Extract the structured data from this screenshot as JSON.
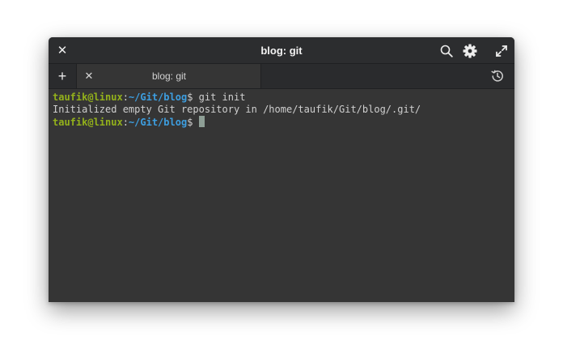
{
  "window": {
    "title": "blog: git"
  },
  "titlebar": {
    "close_icon": "✕",
    "search_icon": "search-icon",
    "settings_icon": "gear-icon",
    "maximize_icon": "maximize-icon"
  },
  "tabs": {
    "add_label": "+",
    "items": [
      {
        "label": "blog: git",
        "close_label": "✕"
      }
    ],
    "history_icon": "history-icon"
  },
  "terminal": {
    "lines": [
      {
        "user_host": "taufik@linux",
        "sep": ":",
        "path": "~/Git/blog",
        "prompt": "$",
        "command": " git init"
      },
      {
        "output": "Initialized empty Git repository in /home/taufik/Git/blog/.git/"
      },
      {
        "user_host": "taufik@linux",
        "sep": ":",
        "path": "~/Git/blog",
        "prompt": "$",
        "command": " "
      }
    ]
  },
  "colors": {
    "user": "#93b11b",
    "path": "#3d9ee0",
    "background": "#353535",
    "cursor": "#8e9f96"
  }
}
